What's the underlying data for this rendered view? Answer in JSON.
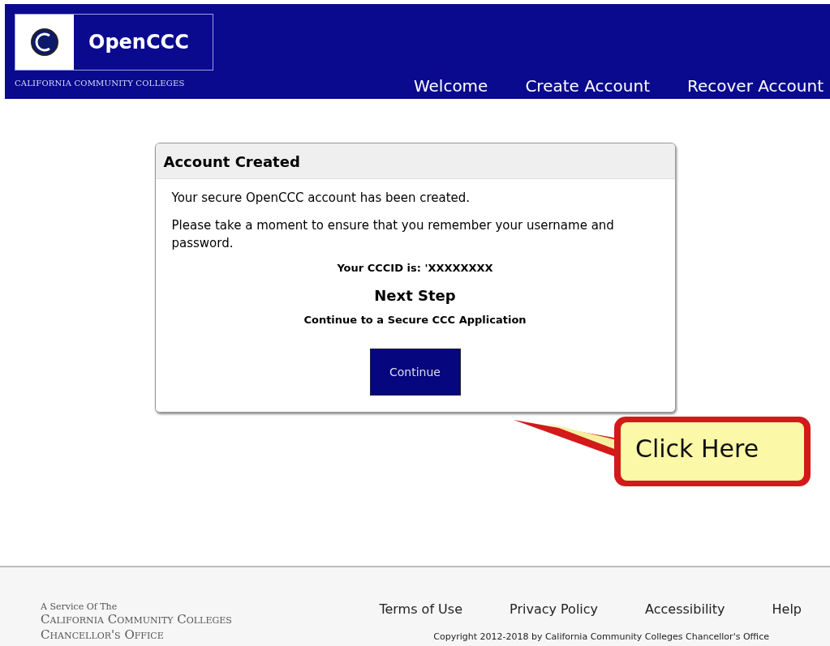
{
  "header": {
    "logo_text": "OpenCCC",
    "subtitle": "CALIFORNIA COMMUNITY COLLEGES",
    "nav": [
      {
        "label": "Welcome"
      },
      {
        "label": "Create Account"
      },
      {
        "label": "Recover Account"
      }
    ]
  },
  "card": {
    "title": "Account Created",
    "message": "Your secure OpenCCC account has been created.",
    "reminder": "Please take a moment to ensure that you remember your username and password.",
    "cccid": "Your CCCID is: 'XXXXXXXX",
    "next_step": "Next Step",
    "next_text": "Continue to a Secure CCC Application",
    "button": "Continue"
  },
  "callout": {
    "text": "Click Here"
  },
  "footer": {
    "service_line": "A Service Of The",
    "org_line_1": "California Community Colleges",
    "org_line_2": "Chancellor's Office",
    "links": [
      {
        "label": "Terms of Use"
      },
      {
        "label": "Privacy Policy"
      },
      {
        "label": "Accessibility"
      },
      {
        "label": "Help"
      }
    ],
    "copyright": "Copyright 2012-2018 by California Community Colleges Chancellor's Office"
  }
}
